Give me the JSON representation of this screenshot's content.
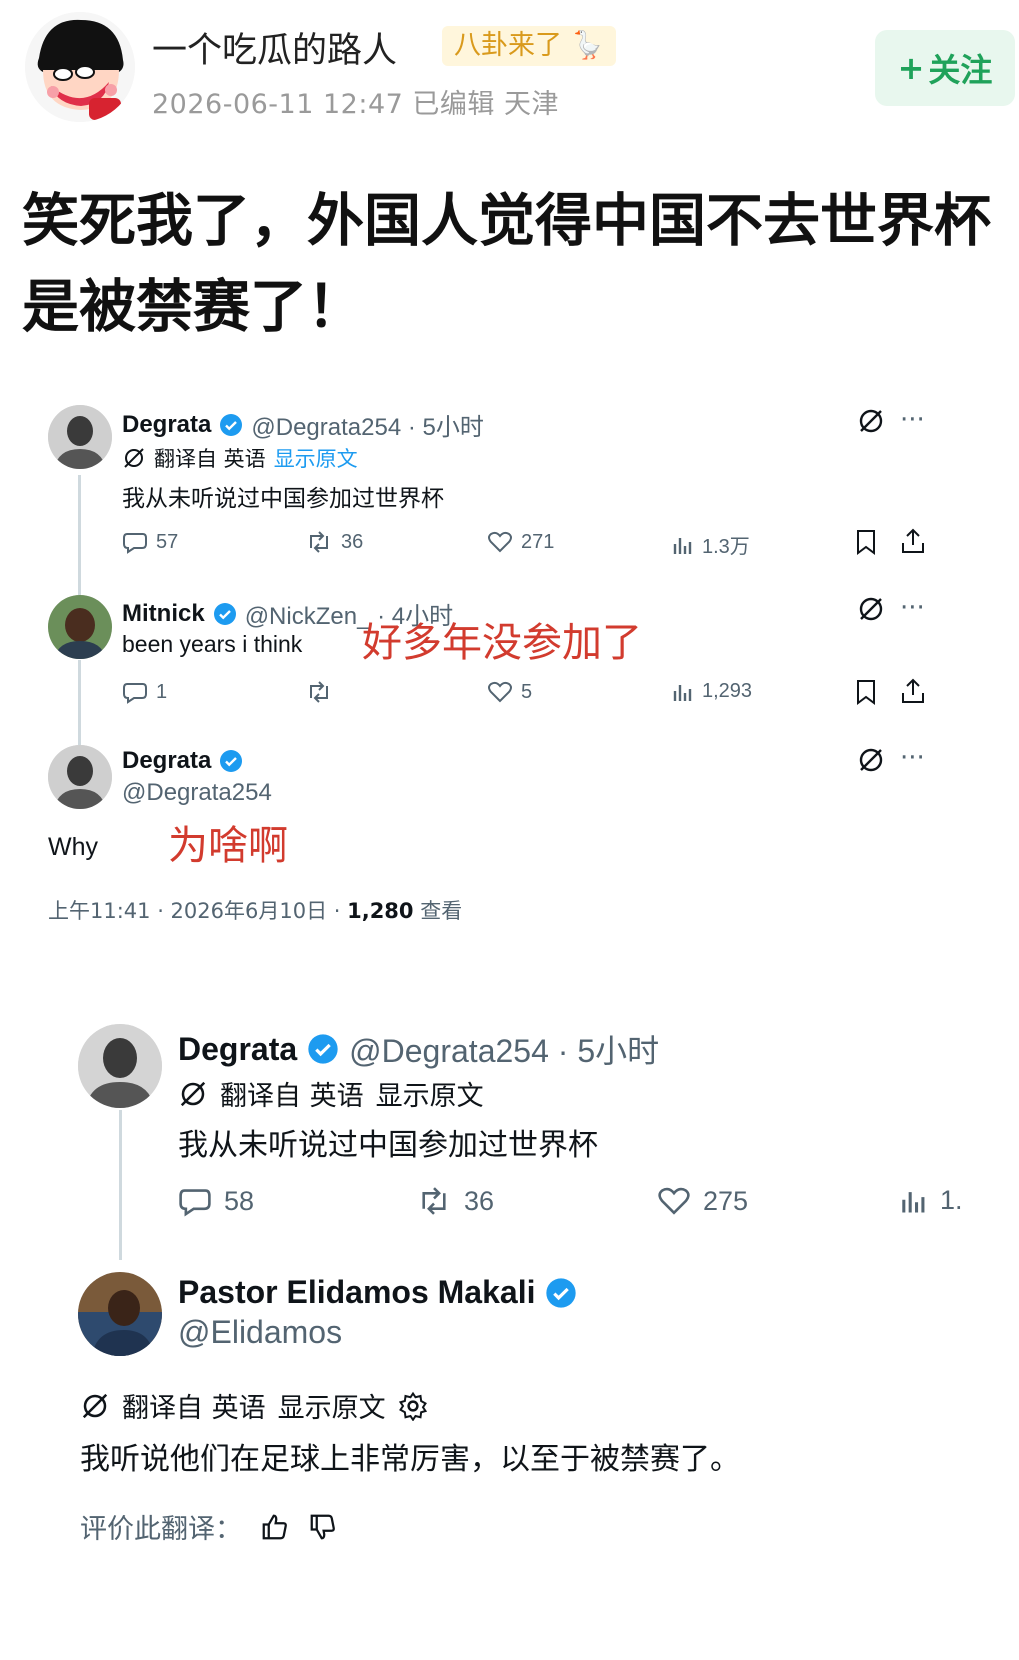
{
  "post": {
    "author": "一个吃瓜的路人",
    "tag": "八卦来了",
    "meta": "2026-06-11 12:47  已编辑  天津",
    "follow_label": "关注",
    "title": "笑死我了，外国人觉得中国不去世界杯是被禁赛了！"
  },
  "tweet1": {
    "post1": {
      "name": "Degrata",
      "handle_time": "@Degrata254 · 5小时",
      "translated_from": "翻译自 英语",
      "show_original": "显示原文",
      "text": "我从未听说过中国参加过世界杯",
      "replies": "57",
      "retweets": "36",
      "likes": "271",
      "views": "1.3万"
    },
    "post2": {
      "name": "Mitnick",
      "handle_time": "@NickZen_ · 4小时",
      "text": "been years i think",
      "note": "好多年没参加了",
      "replies": "1",
      "retweets": "",
      "likes": "5",
      "views": "1,293"
    },
    "post3": {
      "name": "Degrata",
      "handle": "@Degrata254",
      "text": "Why",
      "note": "为啥啊",
      "time": "上午11:41 · 2026年6月10日 · ",
      "views_count": "1,280",
      "views_label": " 查看"
    }
  },
  "tweet2": {
    "post1": {
      "name": "Degrata",
      "handle_time": "@Degrata254 · 5小时",
      "translated_from": "翻译自 英语",
      "show_original": "显示原文",
      "text": "我从未听说过中国参加过世界杯",
      "replies": "58",
      "retweets": "36",
      "likes": "275",
      "views": "1."
    },
    "post2": {
      "name": "Pastor Elidamos Makali",
      "handle": "@Elidamos",
      "translated_from": "翻译自 英语",
      "show_original": "显示原文",
      "text": "我听说他们在足球上非常厉害，以至于被禁赛了。",
      "rate_label": "评价此翻译："
    }
  },
  "colors": {
    "verified": "#1d9bf0",
    "follow_green": "#1fa25a",
    "note_red": "#d23b2e",
    "tag_yellow": "#d99a1c"
  }
}
